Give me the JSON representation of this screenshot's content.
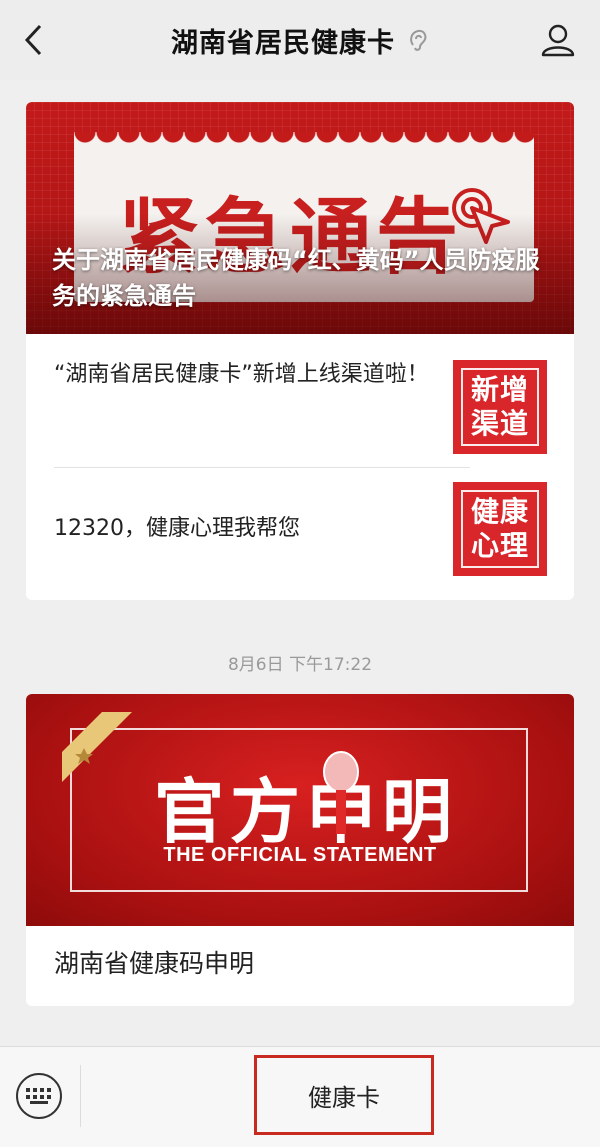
{
  "header": {
    "title": "湖南省居民健康卡"
  },
  "card1": {
    "banner_word": "紧急通告",
    "banner_title": "关于湖南省居民健康码“红、黄码”人员防疫服务的紧急通告",
    "articles": [
      {
        "title": "“湖南省居民健康卡”新增上线渠道啦！",
        "thumb_line1": "新增",
        "thumb_line2": "渠道"
      },
      {
        "title": "12320，健康心理我帮您",
        "thumb_line1": "健康",
        "thumb_line2": "心理"
      }
    ]
  },
  "timestamp": "8月6日 下午17:22",
  "card2": {
    "banner_word": "官方申明",
    "banner_sub": "THE OFFICIAL STATEMENT",
    "caption": "湖南省健康码申明"
  },
  "bottom": {
    "menu_label": "健康卡"
  },
  "colors": {
    "accent_red": "#c31a1a",
    "highlight_border": "#c82a20"
  },
  "icons": [
    "back-arrow-icon",
    "ear-icon",
    "profile-icon",
    "target-cursor-icon",
    "star-ribbon-icon",
    "microphone-icon",
    "keyboard-icon"
  ]
}
